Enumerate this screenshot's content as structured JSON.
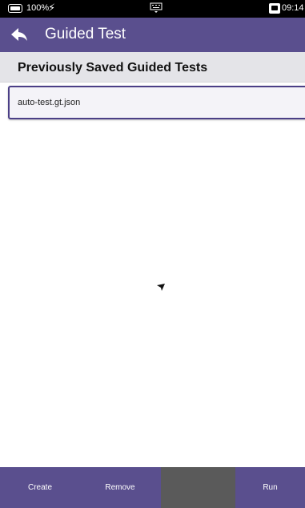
{
  "status_bar": {
    "battery": "100%",
    "time": "09:14",
    "icons": [
      "battery-icon",
      "charging-bolt-icon",
      "keyboard-icon",
      "screen-icon"
    ]
  },
  "action_bar": {
    "title": "Guided Test",
    "back_icon": "back-arrow-icon"
  },
  "section": {
    "title": "Previously Saved Guided Tests"
  },
  "files": [
    {
      "name": "auto-test.gt.json"
    }
  ],
  "bottom_bar": {
    "create_label": "Create",
    "remove_label": "Remove",
    "run_label": "Run"
  },
  "colors": {
    "accent": "#5a4f8e",
    "selected_border": "#4b3f86",
    "header_bg": "#e4e4e8"
  }
}
